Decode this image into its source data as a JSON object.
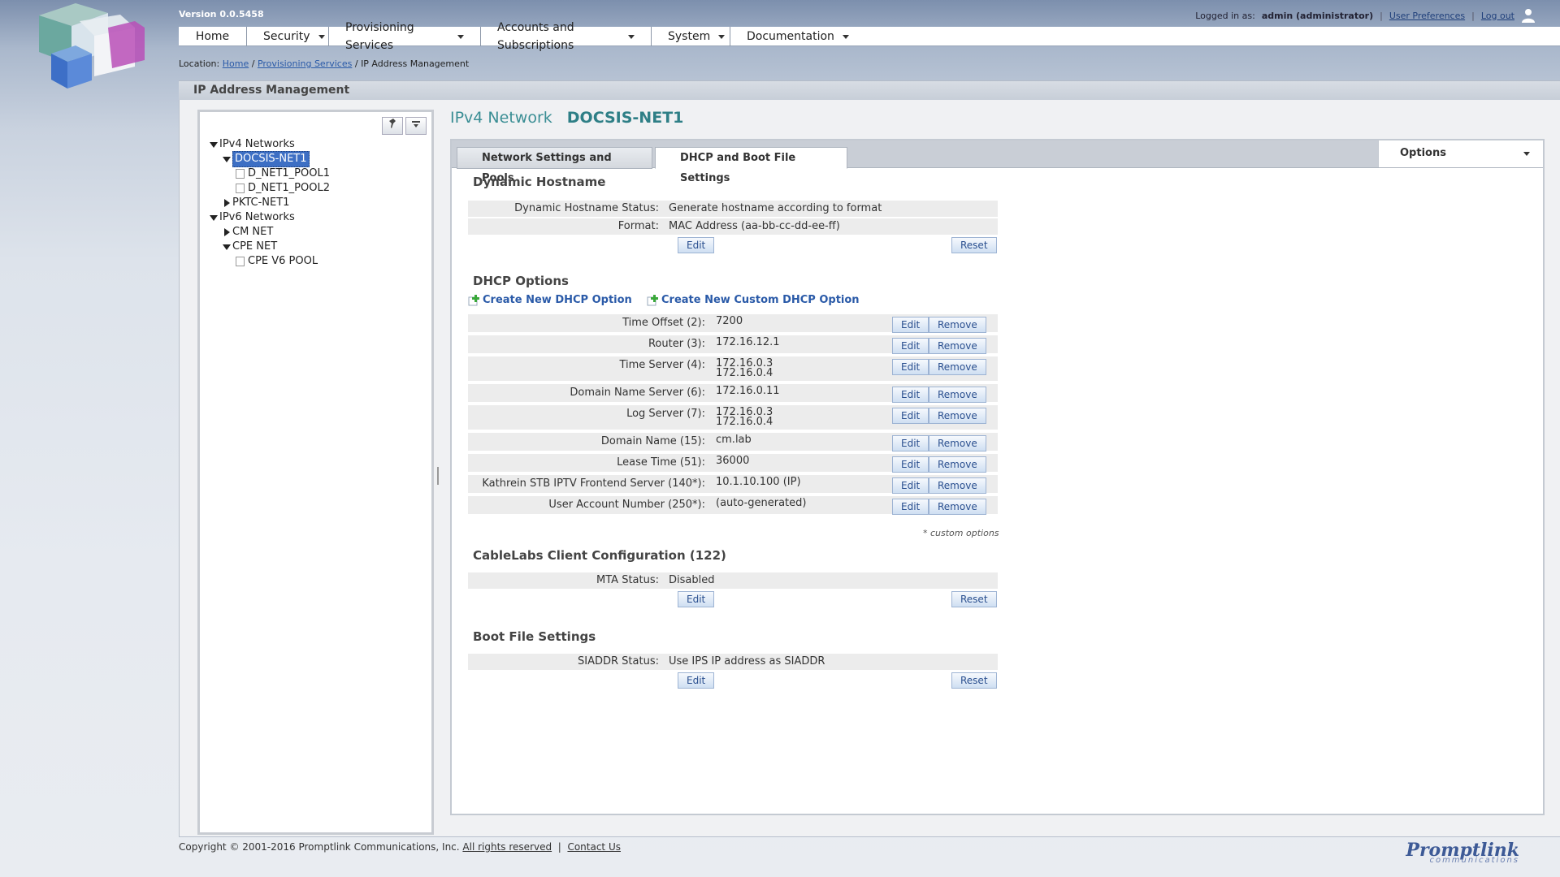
{
  "header": {
    "version": "Version 0.0.5458",
    "logged_in_prefix": "Logged in as:",
    "user": "admin (administrator)",
    "separator": "|",
    "user_prefs": "User Preferences",
    "logout": "Log out"
  },
  "nav": {
    "home": "Home",
    "security": "Security",
    "provisioning": "Provisioning Services",
    "accounts": "Accounts and Subscriptions",
    "system": "System",
    "documentation": "Documentation"
  },
  "breadcrumb": {
    "prefix": "Location:",
    "home": "Home",
    "sep": "/",
    "provisioning": "Provisioning Services",
    "current": "IP Address Management"
  },
  "page": {
    "title": "IP Address Management"
  },
  "tree": {
    "ipv4": "IPv4 Networks",
    "docsis": "DOCSIS-NET1",
    "pool1": "D_NET1_POOL1",
    "pool2": "D_NET1_POOL2",
    "pktc": "PKTC-NET1",
    "ipv6": "IPv6 Networks",
    "cmnet": "CM NET",
    "cpenet": "CPE NET",
    "cpepool": "CPE V6 POOL"
  },
  "content": {
    "type": "IPv4 Network",
    "name": "DOCSIS-NET1",
    "tabs": {
      "network": "Network Settings and Pools",
      "dhcp": "DHCP and Boot File Settings"
    },
    "options": "Options"
  },
  "dynamic_hostname": {
    "title": "Dynamic Hostname",
    "status_label": "Dynamic Hostname Status:",
    "status_value": "Generate hostname according to format",
    "format_label": "Format:",
    "format_value": "MAC Address (aa-bb-cc-dd-ee-ff)",
    "edit": "Edit",
    "reset": "Reset"
  },
  "dhcp_options": {
    "title": "DHCP Options",
    "create": "Create New DHCP Option",
    "create_custom": "Create New Custom DHCP Option",
    "edit": "Edit",
    "remove": "Remove",
    "rows": [
      {
        "label": "Time Offset (2):",
        "value": "7200"
      },
      {
        "label": "Router (3):",
        "value": "172.16.12.1"
      },
      {
        "label": "Time Server (4):",
        "value": "172.16.0.3",
        "value2": "172.16.0.4"
      },
      {
        "label": "Domain Name Server (6):",
        "value": "172.16.0.11"
      },
      {
        "label": "Log Server (7):",
        "value": "172.16.0.3",
        "value2": "172.16.0.4"
      },
      {
        "label": "Domain Name (15):",
        "value": "cm.lab"
      },
      {
        "label": "Lease Time (51):",
        "value": "36000"
      },
      {
        "label": "Kathrein STB IPTV Frontend Server (140*):",
        "value": "10.1.10.100 (IP)"
      },
      {
        "label": "User Account Number (250*):",
        "value": "(auto-generated)"
      }
    ],
    "note": "* custom options"
  },
  "cablelabs": {
    "title": "CableLabs Client Configuration (122)",
    "label": "MTA Status:",
    "value": "Disabled",
    "edit": "Edit",
    "reset": "Reset"
  },
  "boot": {
    "title": "Boot File Settings",
    "label": "SIADDR Status:",
    "value": "Use IPS IP address as SIADDR",
    "edit": "Edit",
    "reset": "Reset"
  },
  "footer": {
    "copyright": "Copyright © 2001-2016 Promptlink Communications, Inc.",
    "rights": "All rights reserved",
    "sep": "|",
    "contact": "Contact Us",
    "brand": "Promptlink",
    "brand_sub": "communications"
  }
}
